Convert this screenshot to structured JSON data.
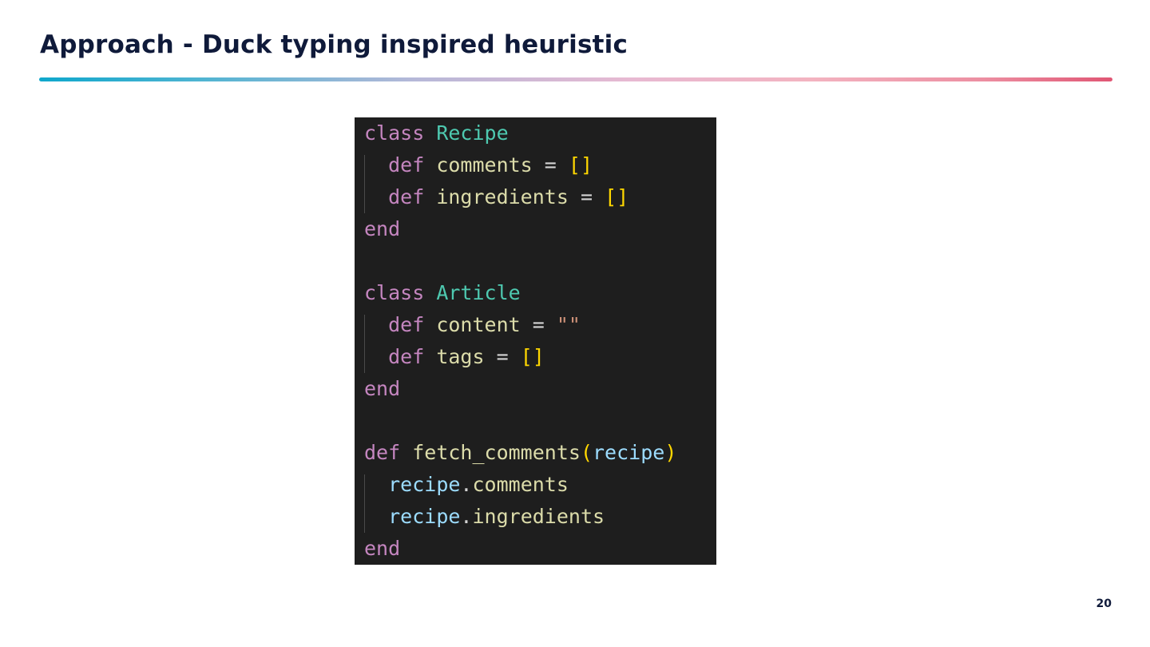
{
  "slide": {
    "title": "Approach - Duck typing inspired heuristic",
    "page_number": "20"
  },
  "colors": {
    "title": "#0f1a3a",
    "code_background": "#1e1e1e",
    "keyword": "#c586c0",
    "class_name": "#4ec9b0",
    "identifier": "#dcdcaa",
    "operator": "#d4d4d4",
    "bracket": "#ffd700",
    "string": "#ce9178",
    "variable": "#9cdcfe"
  },
  "code": {
    "language": "ruby",
    "lines": [
      {
        "tokens": [
          {
            "t": "kw",
            "v": "class"
          },
          {
            "t": "op",
            "v": " "
          },
          {
            "t": "cls",
            "v": "Recipe"
          }
        ]
      },
      {
        "tokens": [
          {
            "t": "op",
            "v": "  "
          },
          {
            "t": "kw",
            "v": "def"
          },
          {
            "t": "op",
            "v": " "
          },
          {
            "t": "fn",
            "v": "comments"
          },
          {
            "t": "op",
            "v": " = "
          },
          {
            "t": "br",
            "v": "[]"
          }
        ]
      },
      {
        "tokens": [
          {
            "t": "op",
            "v": "  "
          },
          {
            "t": "kw",
            "v": "def"
          },
          {
            "t": "op",
            "v": " "
          },
          {
            "t": "fn",
            "v": "ingredients"
          },
          {
            "t": "op",
            "v": " = "
          },
          {
            "t": "br",
            "v": "[]"
          }
        ]
      },
      {
        "tokens": [
          {
            "t": "kw",
            "v": "end"
          }
        ]
      },
      {
        "tokens": []
      },
      {
        "tokens": [
          {
            "t": "kw",
            "v": "class"
          },
          {
            "t": "op",
            "v": " "
          },
          {
            "t": "cls",
            "v": "Article"
          }
        ]
      },
      {
        "tokens": [
          {
            "t": "op",
            "v": "  "
          },
          {
            "t": "kw",
            "v": "def"
          },
          {
            "t": "op",
            "v": " "
          },
          {
            "t": "fn",
            "v": "content"
          },
          {
            "t": "op",
            "v": " = "
          },
          {
            "t": "str",
            "v": "\"\""
          }
        ]
      },
      {
        "tokens": [
          {
            "t": "op",
            "v": "  "
          },
          {
            "t": "kw",
            "v": "def"
          },
          {
            "t": "op",
            "v": " "
          },
          {
            "t": "fn",
            "v": "tags"
          },
          {
            "t": "op",
            "v": " = "
          },
          {
            "t": "br",
            "v": "[]"
          }
        ]
      },
      {
        "tokens": [
          {
            "t": "kw",
            "v": "end"
          }
        ]
      },
      {
        "tokens": []
      },
      {
        "tokens": [
          {
            "t": "kw",
            "v": "def"
          },
          {
            "t": "op",
            "v": " "
          },
          {
            "t": "fn",
            "v": "fetch_comments"
          },
          {
            "t": "br",
            "v": "("
          },
          {
            "t": "var",
            "v": "recipe"
          },
          {
            "t": "br",
            "v": ")"
          }
        ]
      },
      {
        "tokens": [
          {
            "t": "op",
            "v": "  "
          },
          {
            "t": "var",
            "v": "recipe"
          },
          {
            "t": "punc",
            "v": "."
          },
          {
            "t": "fn",
            "v": "comments"
          }
        ]
      },
      {
        "tokens": [
          {
            "t": "op",
            "v": "  "
          },
          {
            "t": "var",
            "v": "recipe"
          },
          {
            "t": "punc",
            "v": "."
          },
          {
            "t": "fn",
            "v": "ingredients"
          }
        ]
      },
      {
        "tokens": [
          {
            "t": "kw",
            "v": "end"
          }
        ]
      }
    ]
  }
}
